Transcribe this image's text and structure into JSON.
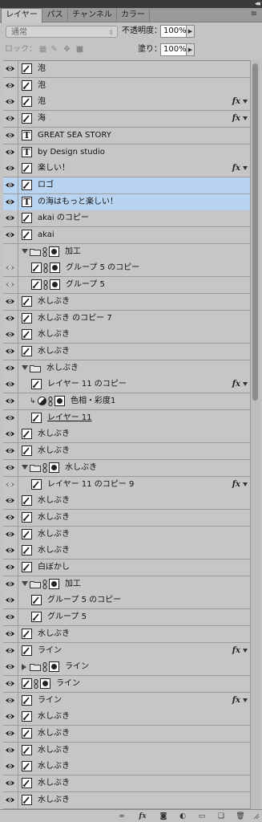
{
  "panel": {
    "tabs": [
      {
        "label": "レイヤー",
        "active": true
      },
      {
        "label": "パス",
        "active": false
      },
      {
        "label": "チャンネル",
        "active": false
      },
      {
        "label": "カラー",
        "active": false
      }
    ],
    "blend_mode": "通常",
    "opacity_label": "不透明度：",
    "opacity_value": "100%",
    "lock_label": "ロック：",
    "fill_label": "塗り：",
    "fill_value": "100%"
  },
  "layers": [
    {
      "name": "泡",
      "type": "brush",
      "indent": 0,
      "eye": "on"
    },
    {
      "name": "泡",
      "type": "brush",
      "indent": 0,
      "eye": "on"
    },
    {
      "name": "泡",
      "type": "brush",
      "indent": 0,
      "eye": "on",
      "fx": true
    },
    {
      "name": "海",
      "type": "brush",
      "indent": 0,
      "eye": "on",
      "fx": true
    },
    {
      "name": "GREAT SEA STORY",
      "type": "text",
      "indent": 0,
      "eye": "on"
    },
    {
      "name": "by Design studio",
      "type": "text",
      "indent": 0,
      "eye": "on"
    },
    {
      "name": "楽しい！",
      "type": "brush",
      "indent": 0,
      "eye": "on",
      "fx": true
    },
    {
      "name": "ロゴ",
      "type": "brush",
      "indent": 0,
      "eye": "on",
      "selected": true
    },
    {
      "name": "の海はもっと楽しい！",
      "type": "text",
      "indent": 0,
      "eye": "on",
      "selected": true
    },
    {
      "name": "akai  のコピー",
      "type": "brush",
      "indent": 0,
      "eye": "on"
    },
    {
      "name": "akai",
      "type": "brush",
      "indent": 0,
      "eye": "on"
    },
    {
      "name": "加工",
      "type": "group",
      "indent": 0,
      "eye": "off",
      "expanded": true,
      "mask": true
    },
    {
      "name": "グループ 5 のコピー",
      "type": "brush",
      "indent": 1,
      "eye": "dim",
      "mask": true
    },
    {
      "name": "グループ 5",
      "type": "brush",
      "indent": 1,
      "eye": "dim",
      "mask": true
    },
    {
      "name": "水しぶき",
      "type": "brush",
      "indent": 0,
      "eye": "on"
    },
    {
      "name": "水しぶき のコピー 7",
      "type": "brush",
      "indent": 0,
      "eye": "on"
    },
    {
      "name": "水しぶき",
      "type": "brush",
      "indent": 0,
      "eye": "on"
    },
    {
      "name": "水しぶき",
      "type": "brush",
      "indent": 0,
      "eye": "on"
    },
    {
      "name": "水しぶき",
      "type": "group",
      "indent": 0,
      "eye": "on",
      "expanded": true
    },
    {
      "name": "レイヤー 11 のコピー",
      "type": "brush",
      "indent": 1,
      "eye": "on",
      "fx": true
    },
    {
      "name": "色相・彩度1",
      "type": "adjust",
      "indent": 1,
      "eye": "on",
      "mask": true
    },
    {
      "name": "レイヤー 11",
      "type": "brush",
      "indent": 1,
      "eye": "on",
      "underline": true
    },
    {
      "name": "水しぶき",
      "type": "brush",
      "indent": 0,
      "eye": "on"
    },
    {
      "name": "水しぶき",
      "type": "brush",
      "indent": 0,
      "eye": "on"
    },
    {
      "name": "水しぶき",
      "type": "group",
      "indent": 0,
      "eye": "on",
      "expanded": true,
      "mask": true
    },
    {
      "name": "レイヤー 11 のコピー 9",
      "type": "brush",
      "indent": 1,
      "eye": "dim",
      "fx": true
    },
    {
      "name": "水しぶき",
      "type": "brush",
      "indent": 0,
      "eye": "on"
    },
    {
      "name": "水しぶき",
      "type": "brush",
      "indent": 0,
      "eye": "on"
    },
    {
      "name": "水しぶき",
      "type": "brush",
      "indent": 0,
      "eye": "on"
    },
    {
      "name": "水しぶき",
      "type": "brush",
      "indent": 0,
      "eye": "on"
    },
    {
      "name": "白ぼかし",
      "type": "brush",
      "indent": 0,
      "eye": "on"
    },
    {
      "name": "加工",
      "type": "group",
      "indent": 0,
      "eye": "on",
      "expanded": true,
      "mask": true
    },
    {
      "name": "グループ 5 のコピー",
      "type": "brush",
      "indent": 1,
      "eye": "on"
    },
    {
      "name": "グループ 5",
      "type": "brush",
      "indent": 1,
      "eye": "on"
    },
    {
      "name": "水しぶき",
      "type": "brush",
      "indent": 0,
      "eye": "on"
    },
    {
      "name": "ライン",
      "type": "brush",
      "indent": 0,
      "eye": "on",
      "fx": true
    },
    {
      "name": "ライン",
      "type": "group",
      "indent": 0,
      "eye": "on",
      "expanded": false,
      "mask": true
    },
    {
      "name": "ライン",
      "type": "brush",
      "indent": 0,
      "eye": "on",
      "mask": true
    },
    {
      "name": "ライン",
      "type": "brush",
      "indent": 0,
      "eye": "on",
      "fx": true
    },
    {
      "name": "水しぶき",
      "type": "brush",
      "indent": 0,
      "eye": "on"
    },
    {
      "name": "水しぶき",
      "type": "brush",
      "indent": 0,
      "eye": "on"
    },
    {
      "name": "水しぶき",
      "type": "brush",
      "indent": 0,
      "eye": "on"
    },
    {
      "name": "水しぶき",
      "type": "brush",
      "indent": 0,
      "eye": "on"
    },
    {
      "name": "水しぶき",
      "type": "brush",
      "indent": 0,
      "eye": "on"
    },
    {
      "name": "水しぶき",
      "type": "brush",
      "indent": 0,
      "eye": "on"
    },
    {
      "name": "水しぶき",
      "type": "brush",
      "indent": 0,
      "eye": "on"
    }
  ],
  "fx_label": "fx",
  "icons": {
    "lock": [
      "lock-transparent-icon",
      "lock-paint-icon",
      "lock-move-icon",
      "lock-all-icon"
    ],
    "bottom": [
      "link-layers-icon",
      "fx-icon",
      "add-mask-icon",
      "adjustment-layer-icon",
      "new-group-icon",
      "new-layer-icon",
      "trash-icon"
    ]
  }
}
